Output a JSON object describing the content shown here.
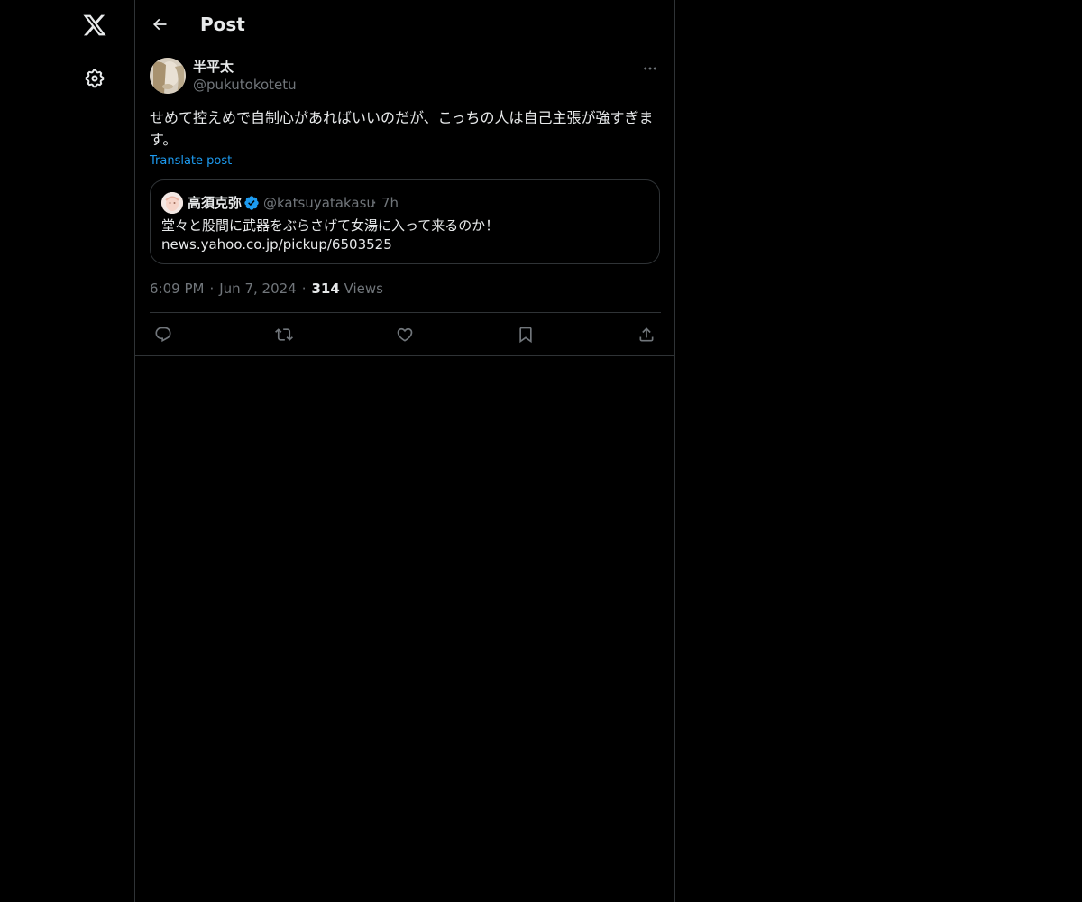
{
  "nav": {
    "logo_icon": "x-logo-icon",
    "settings_icon": "gear-icon"
  },
  "header": {
    "back_icon": "arrow-left-icon",
    "title": "Post"
  },
  "tweet": {
    "display_name": "半平太",
    "handle": "@pukutokotetu",
    "text": "せめて控えめで自制心があればいいのだが、こっちの人は自己主張が強すぎます。",
    "translate_label": "Translate post",
    "time": "6:09 PM",
    "date": "Jun 7, 2024",
    "views_count": "314",
    "views_label": "Views",
    "separator": "·"
  },
  "quote": {
    "display_name": "高須克弥",
    "verified": true,
    "handle": "@katsuyatakasu",
    "separator": "·",
    "time": "7h",
    "text": "堂々と股間に武器をぶらさげて女湯に入って来るのか！",
    "link": "news.yahoo.co.jp/pickup/6503525"
  },
  "actions": [
    "reply-icon",
    "repost-icon",
    "like-icon",
    "bookmark-icon",
    "share-icon"
  ],
  "colors": {
    "background": "#000000",
    "text": "#e7e9ea",
    "secondary": "#71767b",
    "accent": "#1d9bf0",
    "border": "#2f3336"
  }
}
